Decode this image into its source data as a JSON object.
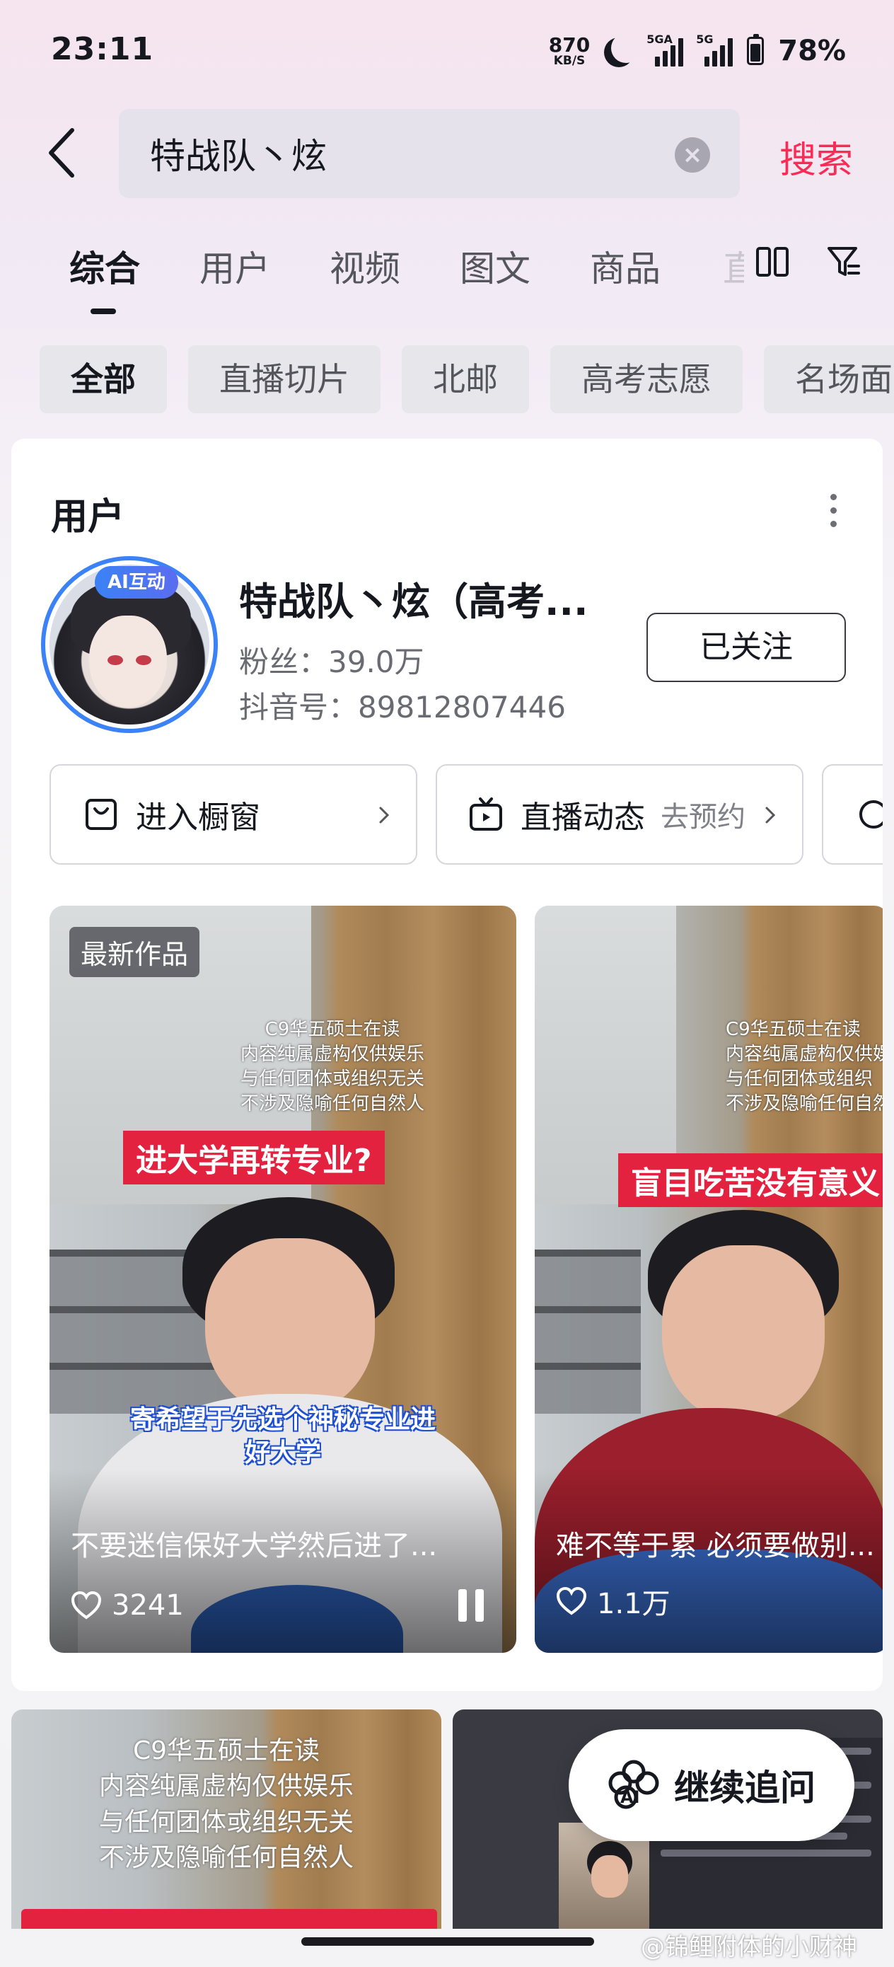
{
  "status_bar": {
    "time": "23:11",
    "net_speed_value": "870",
    "net_speed_unit": "KB/S",
    "sim1_label": "5GA",
    "sim2_label": "5G",
    "battery": "78%"
  },
  "search": {
    "query": "特战队丶炫",
    "submit_label": "搜索"
  },
  "tabs": [
    {
      "label": "综合",
      "active": true
    },
    {
      "label": "用户"
    },
    {
      "label": "视频"
    },
    {
      "label": "图文"
    },
    {
      "label": "商品"
    },
    {
      "label": "直"
    }
  ],
  "chips": [
    "全部",
    "直播切片",
    "北邮",
    "高考志愿",
    "名场面"
  ],
  "user_section": {
    "title": "用户",
    "avatar_badge": "AI互动",
    "name": "特战队丶炫（高考...",
    "fans": "粉丝：39.0万",
    "douyin_id": "抖音号：89812807446",
    "follow_label": "已关注",
    "actions": [
      {
        "label": "进入橱窗",
        "icon": "shop-bag-icon"
      },
      {
        "label": "直播动态",
        "sub": "去预约",
        "icon": "tv-icon"
      }
    ]
  },
  "videos": [
    {
      "tag": "最新作品",
      "watermark_lines": [
        "C9华五硕士在读",
        "内容纯属虚构仅供娱乐",
        "与任何团体或组织无关",
        "不涉及隐喻任何自然人"
      ],
      "banner": "进大学再转专业?",
      "subtitle_lines": [
        "寄希望于先选个神秘专业进",
        "好大学"
      ],
      "desc": "不要迷信保好大学然后进了...",
      "likes": "3241"
    },
    {
      "watermark_lines": [
        "C9华五硕士在读",
        "内容纯属虚构仅供娱乐",
        "与任何团体或组织",
        "不涉及隐喻任何自然"
      ],
      "banner": "盲目吃苦没有意义",
      "desc": "难不等于累 必须要做别...",
      "likes": "1.1万"
    }
  ],
  "bottom_tiles": [
    {
      "lines": [
        "C9华五硕士在读",
        "内容纯属虚构仅供娱乐",
        "与任何团体或组织无关",
        "不涉及隐喻任何自然人"
      ]
    }
  ],
  "ai_button": {
    "label": "继续追问",
    "icon_text": "AI"
  },
  "watermark": "@锦鲤附体的小财神",
  "colors": {
    "accent": "#fa2c55",
    "banner_red": "#e3223f",
    "avatar_ring": "#3b82f6"
  }
}
